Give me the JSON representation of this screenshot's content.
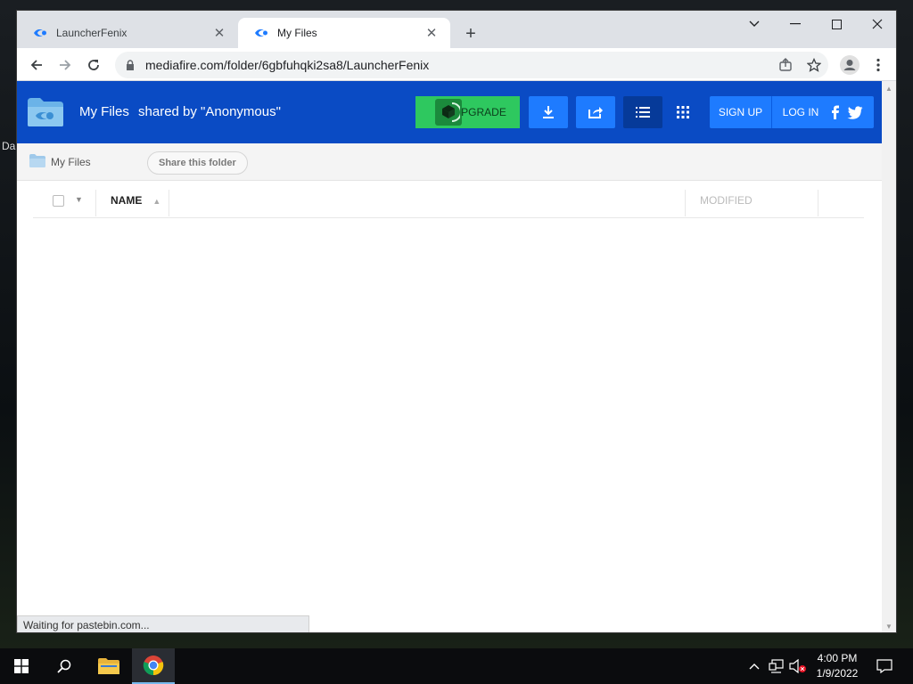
{
  "desktop": {
    "fragment_1": "Da"
  },
  "browser": {
    "tabs": [
      {
        "label": "LauncherFenix",
        "active": false
      },
      {
        "label": "My Files",
        "active": true
      }
    ],
    "address": "mediafire.com/folder/6gbfuhqki2sa8/LauncherFenix",
    "status_text": "Waiting for pastebin.com..."
  },
  "page": {
    "header": {
      "title": "My Files",
      "shared_by": "shared by \"Anonymous\"",
      "upgrade_label": "PGRADE",
      "signup_label": "SIGN UP",
      "login_label": "LOG IN"
    },
    "breadcrumb": {
      "label": "My Files"
    },
    "share_button": "Share this folder",
    "columns": {
      "name": "NAME",
      "modified": "MODIFIED"
    }
  },
  "taskbar": {
    "time": "4:00 PM",
    "date": "1/9/2022"
  },
  "colors": {
    "mediafire_blue": "#0a4bc4",
    "button_blue": "#1e7bff",
    "upgrade_green": "#2ec85f"
  }
}
